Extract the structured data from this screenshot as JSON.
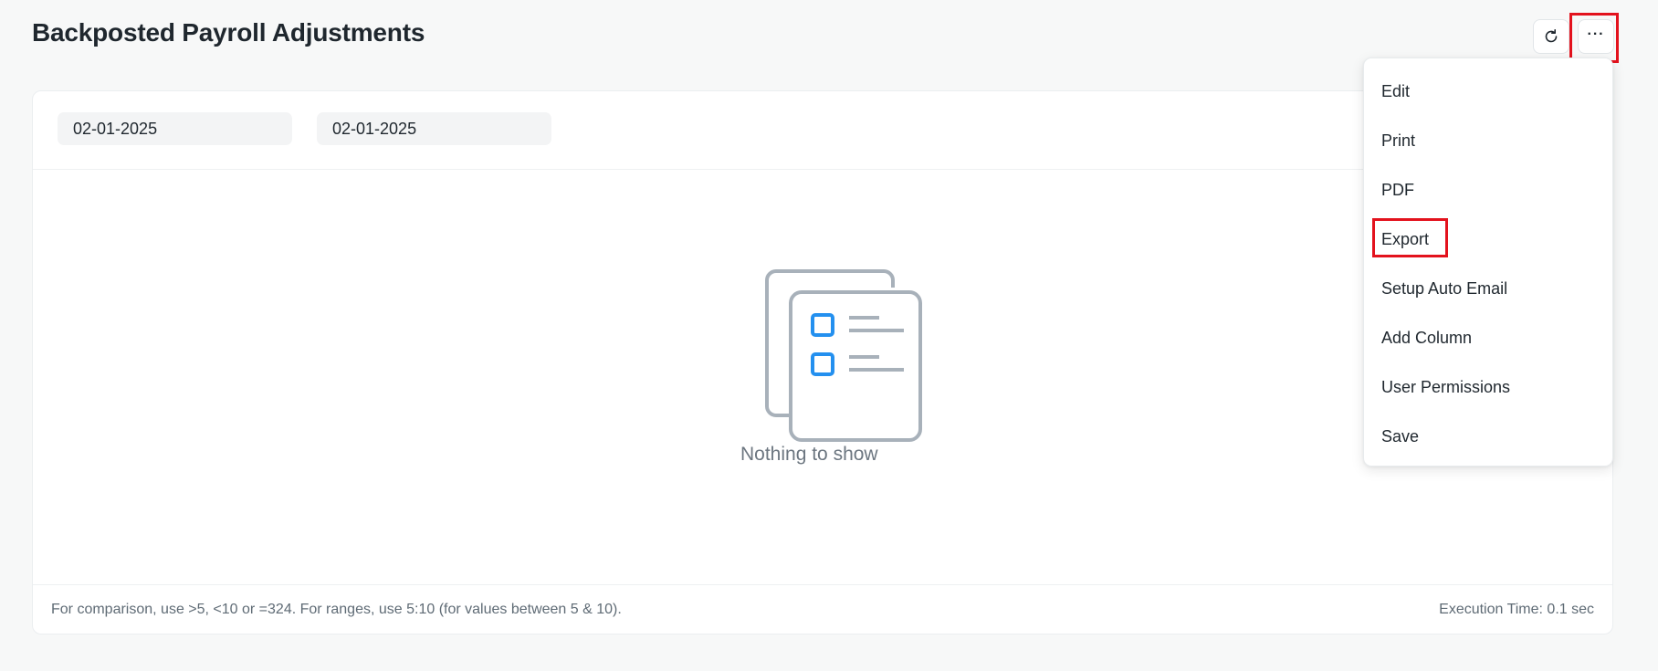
{
  "page": {
    "title": "Backposted Payroll Adjustments"
  },
  "toolbar": {
    "refresh_icon": "refresh-icon",
    "more_label": "···"
  },
  "filters": {
    "from_date": "02-01-2025",
    "to_date": "02-01-2025"
  },
  "empty_state": {
    "message": "Nothing to show",
    "icon": "empty-list-icon"
  },
  "footer": {
    "hint": "For comparison, use >5, <10 or =324. For ranges, use 5:10 (for values between 5 & 10).",
    "execution_time": "Execution Time: 0.1 sec"
  },
  "menu": {
    "items": [
      {
        "label": "Edit"
      },
      {
        "label": "Print"
      },
      {
        "label": "PDF"
      },
      {
        "label": "Export"
      },
      {
        "label": "Setup Auto Email"
      },
      {
        "label": "Add Column"
      },
      {
        "label": "User Permissions"
      },
      {
        "label": "Save"
      }
    ]
  },
  "colors": {
    "background": "#f7f8f8",
    "highlight": "#e3121d",
    "illustration_gray": "#a8b1ba",
    "illustration_blue": "#2490ef"
  }
}
